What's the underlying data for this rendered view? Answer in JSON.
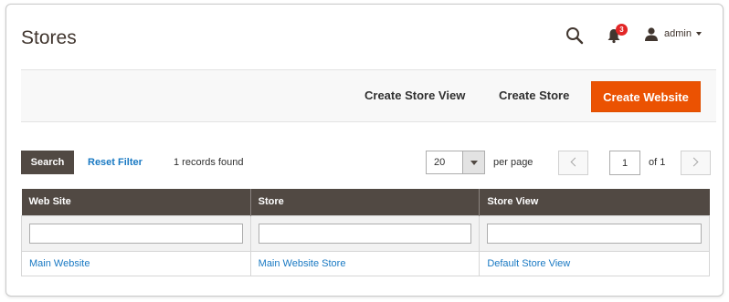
{
  "header": {
    "title": "Stores",
    "notifications_count": "3",
    "user_name": "admin"
  },
  "actions": {
    "create_store_view": "Create Store View",
    "create_store": "Create Store",
    "create_website": "Create Website"
  },
  "toolbar": {
    "search_label": "Search",
    "reset_filter_label": "Reset Filter",
    "records_found": "1 records found",
    "per_page_value": "20",
    "per_page_label": "per page",
    "current_page": "1",
    "total_pages_label": "of 1"
  },
  "grid": {
    "columns": [
      "Web Site",
      "Store",
      "Store View"
    ],
    "rows": [
      [
        "Main Website",
        "Main Website Store",
        "Default Store View"
      ]
    ]
  },
  "colors": {
    "primary": "#eb5202",
    "header_dark": "#514943",
    "link": "#1979c3",
    "badge": "#e22626"
  },
  "icons": {
    "search": "search-icon",
    "notifications": "bell-icon",
    "user": "user-icon"
  }
}
